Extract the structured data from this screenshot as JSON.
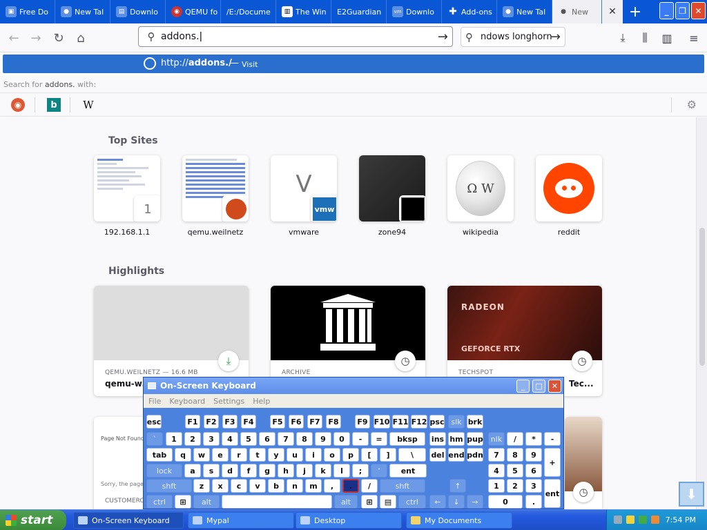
{
  "tabs": [
    {
      "label": "Free Do",
      "icon": "page-icon"
    },
    {
      "label": "New Tal",
      "icon": "mascot-icon"
    },
    {
      "label": "Downlo",
      "icon": "download-icon"
    },
    {
      "label": "QEMU fo",
      "icon": "qemu-icon"
    },
    {
      "label": "/E:/Docume",
      "icon": ""
    },
    {
      "label": "The Win",
      "icon": "archive-icon"
    },
    {
      "label": "E2Guardian",
      "icon": ""
    },
    {
      "label": "Downlo",
      "icon": "vmware-icon"
    },
    {
      "label": "Add-ons",
      "icon": "puzzle-icon"
    },
    {
      "label": "New Tal",
      "icon": "mascot-icon"
    },
    {
      "label": "New",
      "icon": "mascot-icon"
    }
  ],
  "url_bar": {
    "value": "addons."
  },
  "search_bar": {
    "value": "ndows longhorn"
  },
  "suggestion": {
    "url_prefix": "http://",
    "url_bold": "addons./",
    "separator": "—",
    "action": "Visit"
  },
  "search_for": {
    "prefix": "Search for ",
    "query": "addons.",
    "suffix": " with:"
  },
  "engines": [
    "DuckDuckGo",
    "Bing",
    "Wikipedia"
  ],
  "top_sites": {
    "heading": "Top Sites",
    "items": [
      {
        "label": "192.168.1.1",
        "badge": "1"
      },
      {
        "label": "qemu.weilnetz"
      },
      {
        "label": "vmware",
        "letter": "V",
        "badge": "vmw"
      },
      {
        "label": "zone94"
      },
      {
        "label": "wikipedia"
      },
      {
        "label": "reddit"
      }
    ]
  },
  "highlights": {
    "heading": "Highlights",
    "items": [
      {
        "source": "QEMU.WEILNETZ — 16.6 MB",
        "title": "qemu-w3"
      },
      {
        "source": "ARCHIVE",
        "title": ""
      },
      {
        "source": "TECHSPOT",
        "title": "Tec...",
        "img_text1": "RADEON",
        "img_text2": "GEFORCE RTX"
      }
    ],
    "row2": [
      {
        "source": "CUSTOMERC",
        "title": "Page Not Found",
        "body": "Sorry, the page yo"
      }
    ]
  },
  "osk": {
    "title": "On-Screen Keyboard",
    "menu": [
      "File",
      "Keyboard",
      "Settings",
      "Help"
    ],
    "rows": [
      [
        "esc",
        "F1",
        "F2",
        "F3",
        "F4",
        "F5",
        "F6",
        "F7",
        "F8",
        "F9",
        "F10",
        "F11",
        "F12",
        "psc",
        "slk",
        "brk"
      ],
      [
        "`",
        "1",
        "2",
        "3",
        "4",
        "5",
        "6",
        "7",
        "8",
        "9",
        "0",
        "-",
        "=",
        "bksp",
        "ins",
        "hm",
        "pup",
        "nlk",
        "/",
        "*",
        "-"
      ],
      [
        "tab",
        "q",
        "w",
        "e",
        "r",
        "t",
        "y",
        "u",
        "i",
        "o",
        "p",
        "[",
        "]",
        "\\",
        "del",
        "end",
        "pdn",
        "7",
        "8",
        "9",
        "+"
      ],
      [
        "lock",
        "a",
        "s",
        "d",
        "f",
        "g",
        "h",
        "j",
        "k",
        "l",
        ";",
        "'",
        "ent",
        "4",
        "5",
        "6"
      ],
      [
        "shft",
        "z",
        "x",
        "c",
        "v",
        "b",
        "n",
        "m",
        ",",
        ".",
        "/",
        "shft",
        "↑",
        "1",
        "2",
        "3",
        "ent"
      ],
      [
        "ctrl",
        "⊞",
        "alt",
        "",
        "alt",
        "⊞",
        "▤",
        "ctrl",
        "←",
        "↓",
        "→",
        "0",
        "."
      ]
    ]
  },
  "taskbar": {
    "start": "start",
    "items": [
      "On-Screen Keyboard",
      "Mypal",
      "Desktop",
      "My Documents"
    ],
    "clock": "7:54 PM"
  },
  "colors": {
    "tabbar": "#0a57d6",
    "suggestion": "#2a6fce",
    "osk": "#4b82dd",
    "taskbar": "#245adf",
    "start": "#3a8a3a"
  }
}
